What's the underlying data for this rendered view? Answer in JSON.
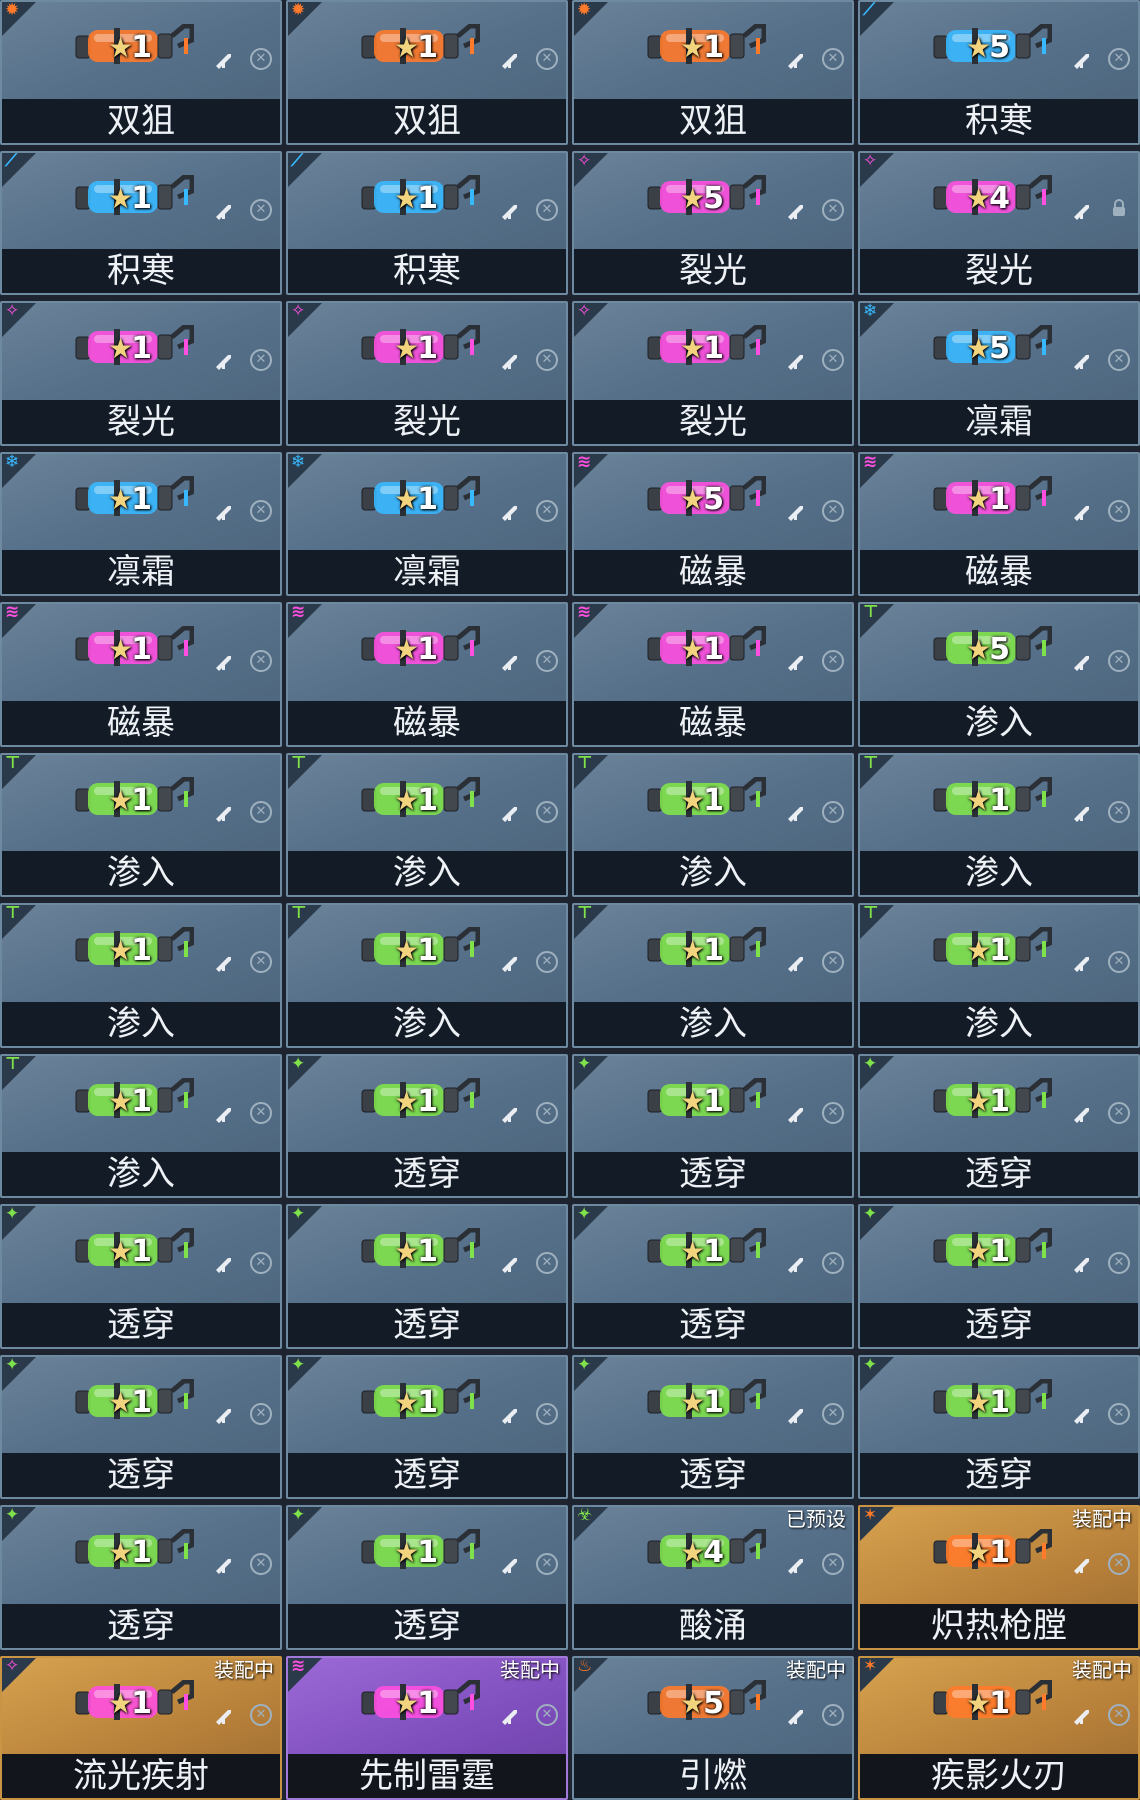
{
  "cards": [
    {
      "name": "双狙",
      "level": "1",
      "color": "orange",
      "style": "normal",
      "corner_icon": "gear-icon"
    },
    {
      "name": "双狙",
      "level": "1",
      "color": "orange",
      "style": "normal",
      "corner_icon": "gear-icon"
    },
    {
      "name": "双狙",
      "level": "1",
      "color": "orange",
      "style": "normal",
      "corner_icon": "gear-icon"
    },
    {
      "name": "积寒",
      "level": "5",
      "color": "blue",
      "style": "normal",
      "corner_icon": "frost-icon"
    },
    {
      "name": "积寒",
      "level": "1",
      "color": "blue",
      "style": "normal",
      "corner_icon": "frost-icon"
    },
    {
      "name": "积寒",
      "level": "1",
      "color": "blue",
      "style": "normal",
      "corner_icon": "frost-icon"
    },
    {
      "name": "裂光",
      "level": "5",
      "color": "pink",
      "style": "normal",
      "corner_icon": "split-light-icon"
    },
    {
      "name": "裂光",
      "level": "4",
      "color": "pink",
      "style": "normal",
      "corner_icon": "split-light-icon",
      "locked": true
    },
    {
      "name": "裂光",
      "level": "1",
      "color": "pink",
      "style": "normal",
      "corner_icon": "split-light-icon"
    },
    {
      "name": "裂光",
      "level": "1",
      "color": "pink",
      "style": "normal",
      "corner_icon": "split-light-icon"
    },
    {
      "name": "裂光",
      "level": "1",
      "color": "pink",
      "style": "normal",
      "corner_icon": "split-light-icon"
    },
    {
      "name": "凛霜",
      "level": "5",
      "color": "blue",
      "style": "normal",
      "corner_icon": "ice-crystal-icon"
    },
    {
      "name": "凛霜",
      "level": "1",
      "color": "blue",
      "style": "normal",
      "corner_icon": "ice-crystal-icon"
    },
    {
      "name": "凛霜",
      "level": "1",
      "color": "blue",
      "style": "normal",
      "corner_icon": "ice-crystal-icon"
    },
    {
      "name": "磁暴",
      "level": "5",
      "color": "pink",
      "style": "normal",
      "corner_icon": "storm-icon"
    },
    {
      "name": "磁暴",
      "level": "1",
      "color": "pink",
      "style": "normal",
      "corner_icon": "storm-icon"
    },
    {
      "name": "磁暴",
      "level": "1",
      "color": "pink",
      "style": "normal",
      "corner_icon": "storm-icon"
    },
    {
      "name": "磁暴",
      "level": "1",
      "color": "pink",
      "style": "normal",
      "corner_icon": "storm-icon"
    },
    {
      "name": "磁暴",
      "level": "1",
      "color": "pink",
      "style": "normal",
      "corner_icon": "storm-icon"
    },
    {
      "name": "渗入",
      "level": "5",
      "color": "green",
      "style": "normal",
      "corner_icon": "infiltrate-icon"
    },
    {
      "name": "渗入",
      "level": "1",
      "color": "green",
      "style": "normal",
      "corner_icon": "infiltrate-icon"
    },
    {
      "name": "渗入",
      "level": "1",
      "color": "green",
      "style": "normal",
      "corner_icon": "infiltrate-icon"
    },
    {
      "name": "渗入",
      "level": "1",
      "color": "green",
      "style": "normal",
      "corner_icon": "infiltrate-icon"
    },
    {
      "name": "渗入",
      "level": "1",
      "color": "green",
      "style": "normal",
      "corner_icon": "infiltrate-icon"
    },
    {
      "name": "渗入",
      "level": "1",
      "color": "green",
      "style": "normal",
      "corner_icon": "infiltrate-icon"
    },
    {
      "name": "渗入",
      "level": "1",
      "color": "green",
      "style": "normal",
      "corner_icon": "infiltrate-icon"
    },
    {
      "name": "渗入",
      "level": "1",
      "color": "green",
      "style": "normal",
      "corner_icon": "infiltrate-icon"
    },
    {
      "name": "渗入",
      "level": "1",
      "color": "green",
      "style": "normal",
      "corner_icon": "infiltrate-icon"
    },
    {
      "name": "渗入",
      "level": "1",
      "color": "green",
      "style": "normal",
      "corner_icon": "infiltrate-icon"
    },
    {
      "name": "透穿",
      "level": "1",
      "color": "green",
      "style": "normal",
      "corner_icon": "pierce-icon"
    },
    {
      "name": "透穿",
      "level": "1",
      "color": "green",
      "style": "normal",
      "corner_icon": "pierce-icon"
    },
    {
      "name": "透穿",
      "level": "1",
      "color": "green",
      "style": "normal",
      "corner_icon": "pierce-icon"
    },
    {
      "name": "透穿",
      "level": "1",
      "color": "green",
      "style": "normal",
      "corner_icon": "pierce-icon"
    },
    {
      "name": "透穿",
      "level": "1",
      "color": "green",
      "style": "normal",
      "corner_icon": "pierce-icon"
    },
    {
      "name": "透穿",
      "level": "1",
      "color": "green",
      "style": "normal",
      "corner_icon": "pierce-icon"
    },
    {
      "name": "透穿",
      "level": "1",
      "color": "green",
      "style": "normal",
      "corner_icon": "pierce-icon"
    },
    {
      "name": "透穿",
      "level": "1",
      "color": "green",
      "style": "normal",
      "corner_icon": "pierce-icon"
    },
    {
      "name": "透穿",
      "level": "1",
      "color": "green",
      "style": "normal",
      "corner_icon": "pierce-icon"
    },
    {
      "name": "透穿",
      "level": "1",
      "color": "green",
      "style": "normal",
      "corner_icon": "pierce-icon"
    },
    {
      "name": "透穿",
      "level": "1",
      "color": "green",
      "style": "normal",
      "corner_icon": "pierce-icon"
    },
    {
      "name": "透穿",
      "level": "1",
      "color": "green",
      "style": "normal",
      "corner_icon": "pierce-icon"
    },
    {
      "name": "透穿",
      "level": "1",
      "color": "green",
      "style": "normal",
      "corner_icon": "pierce-icon"
    },
    {
      "name": "酸涌",
      "level": "4",
      "color": "green",
      "style": "normal",
      "corner_icon": "acid-icon",
      "status": "已预设"
    },
    {
      "name": "炽热枪膛",
      "level": "1",
      "color": "orange",
      "style": "gold",
      "corner_icon": "flame-icon",
      "status": "装配中"
    },
    {
      "name": "流光疾射",
      "level": "1",
      "color": "pink",
      "style": "gold",
      "corner_icon": "split-light-icon",
      "status": "装配中"
    },
    {
      "name": "先制雷霆",
      "level": "1",
      "color": "pink",
      "style": "purple",
      "corner_icon": "storm-icon",
      "status": "装配中"
    },
    {
      "name": "引燃",
      "level": "5",
      "color": "orange",
      "style": "normal",
      "corner_icon": "fire-icon",
      "status": "装配中"
    },
    {
      "name": "疾影火刃",
      "level": "1",
      "color": "orange",
      "style": "gold",
      "corner_icon": "flame-icon",
      "status": "装配中"
    }
  ],
  "colors": {
    "orange": "#ff7a2a",
    "blue": "#38b9ff",
    "pink": "#ff4fe0",
    "green": "#7fe24a"
  }
}
